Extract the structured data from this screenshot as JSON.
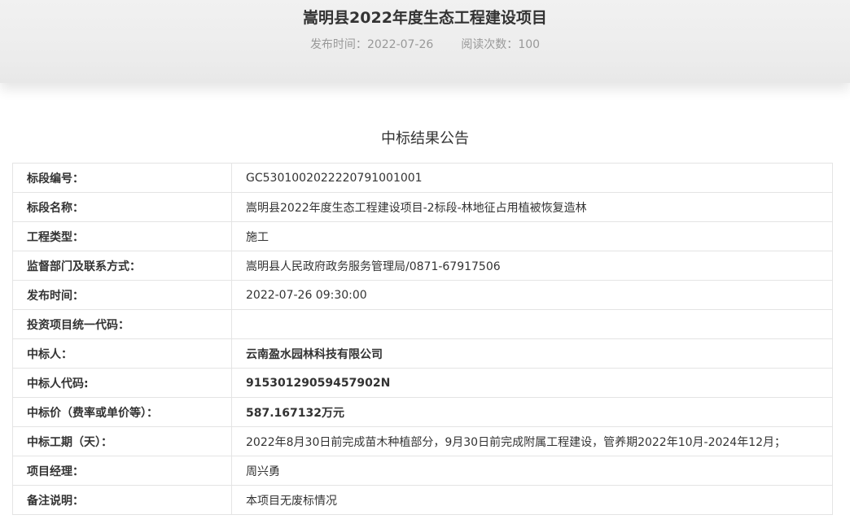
{
  "header": {
    "title": "嵩明县2022年度生态工程建设项目",
    "publish_label": "发布时间：",
    "publish_date": "2022-07-26",
    "views_label": "阅读次数：",
    "views_count": "100"
  },
  "notice": {
    "title": "中标结果公告"
  },
  "table": {
    "rows": [
      {
        "label": "标段编号：",
        "value": "GC5301002022220791001001"
      },
      {
        "label": "标段名称：",
        "value": "嵩明县2022年度生态工程建设项目-2标段-林地征占用植被恢复造林"
      },
      {
        "label": "工程类型：",
        "value": "施工"
      },
      {
        "label": "监督部门及联系方式：",
        "value": "嵩明县人民政府政务服务管理局/0871-67917506"
      },
      {
        "label": "发布时间：",
        "value": "2022-07-26 09:30:00"
      },
      {
        "label": "投资项目统一代码：",
        "value": ""
      },
      {
        "label": "中标人：",
        "value": "云南盈水园林科技有限公司"
      },
      {
        "label": "中标人代码:",
        "value": "91530129059457902N"
      },
      {
        "label": "中标价（费率或单价等）：",
        "value": "587.167132万元"
      },
      {
        "label": "中标工期（天）：",
        "value": "2022年8月30日前完成苗木种植部分，9月30日前完成附属工程建设，管养期2022年10月-2024年12月；"
      },
      {
        "label": "项目经理：",
        "value": "周兴勇"
      },
      {
        "label": "备注说明：",
        "value": "本项目无废标情况"
      }
    ]
  }
}
